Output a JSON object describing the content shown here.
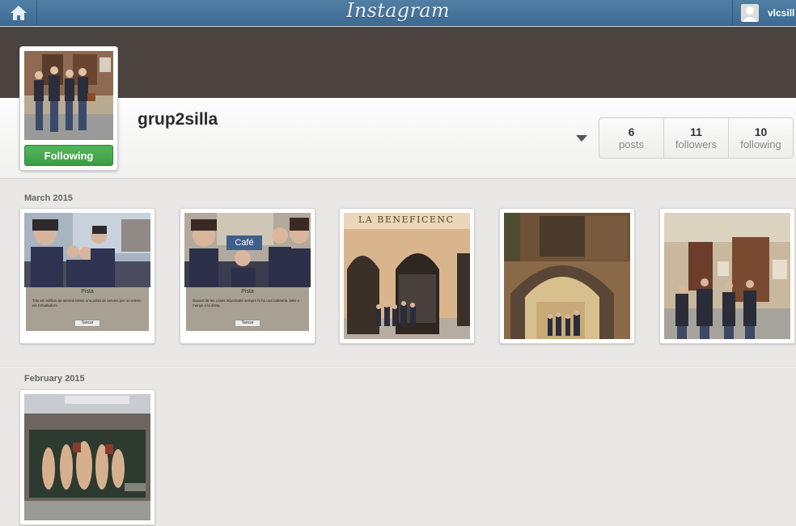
{
  "topbar": {
    "logo": "Instagram",
    "user_name": "vlcsill"
  },
  "profile": {
    "username": "grup2silla",
    "follow_label": "Following",
    "stats": [
      {
        "num": "6",
        "label": "posts"
      },
      {
        "num": "11",
        "label": "followers"
      },
      {
        "num": "10",
        "label": "following"
      }
    ]
  },
  "sections": [
    {
      "label": "March 2015"
    },
    {
      "label": "February 2015"
    }
  ],
  "photos": {
    "p1": {
      "title": "Pista",
      "text": "Tots els edificis de serveis tenen una porta de serveis per on entren els treballadors.",
      "button": "Tancar"
    },
    "p2": {
      "sign": "Café",
      "title": "Pista",
      "text": "Davant de les coses importants sempre hi ha una cafeteria. Més o menys a la dreta.",
      "button": "Tancar"
    },
    "p3": {
      "sign": "LA BENEFICENC"
    }
  },
  "colors": {
    "topbar": "#3e6a92",
    "cover": "#4b4340",
    "follow_green": "#3d9c45"
  }
}
